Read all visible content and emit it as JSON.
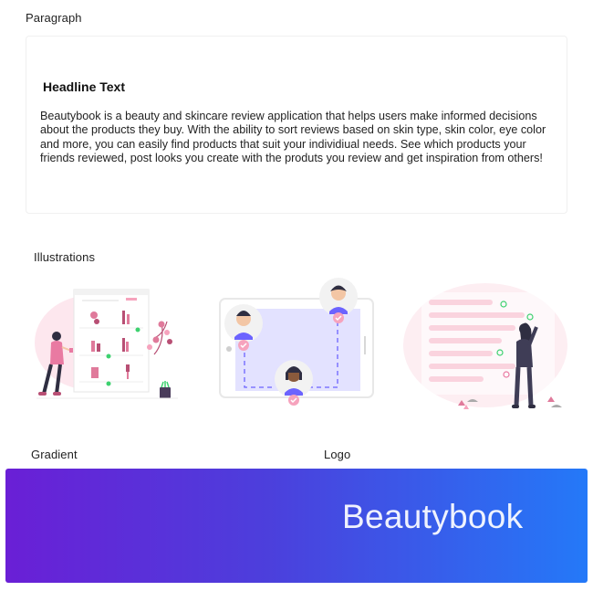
{
  "labels": {
    "paragraph": "Paragraph",
    "illustrations": "Illustrations",
    "gradient": "Gradient",
    "logo": "Logo"
  },
  "paragraph_card": {
    "headline": "Headline Text",
    "body": "Beautybook is a beauty and skincare review application that helps users make informed decisions about the products they buy. With the ability to sort reviews based on skin type, skin color, eye color and more, you can easily find products that suit your individiual needs. See which products your friends reviewed, post looks you create with the produts you review and get inspiration from others!"
  },
  "illustrations": [
    {
      "name": "shopping-products-illustration"
    },
    {
      "name": "profiles-connection-illustration"
    },
    {
      "name": "reviews-board-illustration"
    }
  ],
  "logo": {
    "text": "Beautybook"
  },
  "colors": {
    "gradient_start": "#6a1fd6",
    "gradient_end": "#2479f8",
    "accent_pink": "#e97aa2",
    "accent_purple": "#6c63ff",
    "accent_green": "#3dd16f"
  }
}
